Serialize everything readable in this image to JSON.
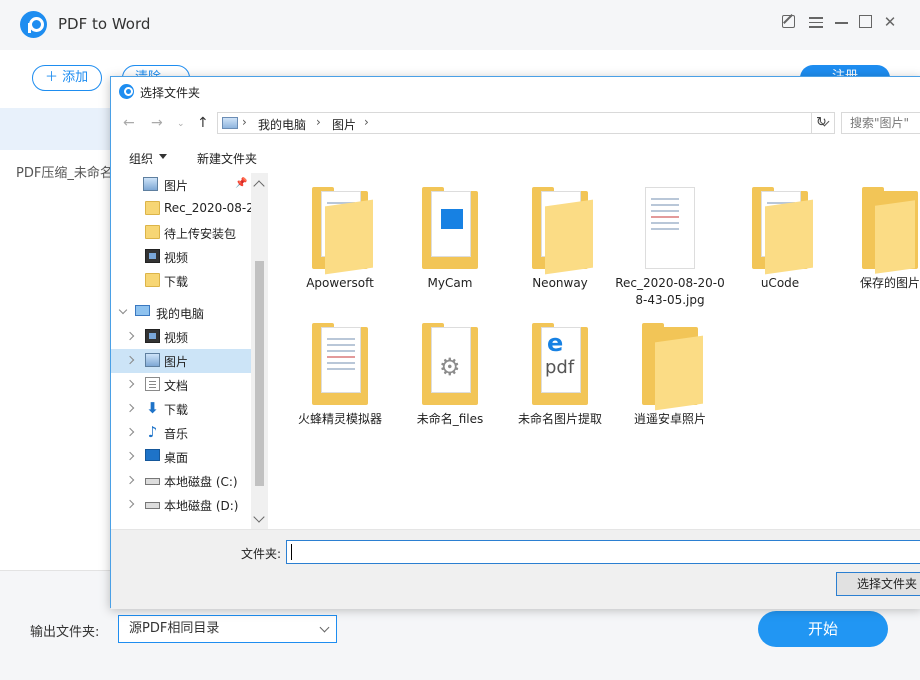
{
  "app": {
    "title": "PDF to Word",
    "add_label": "＋ 添加",
    "clear_label": "清除",
    "register_label": "注册",
    "file_row": "PDF压缩_未命名",
    "output_label": "输出文件夹:",
    "output_value": "源PDF相同目录",
    "start_label": "开始",
    "accent": "#1e8df0"
  },
  "dialog": {
    "title": "选择文件夹",
    "breadcrumbs": [
      "我的电脑",
      "图片"
    ],
    "search_placeholder": "搜索\"图片\"",
    "toolbar": {
      "organize": "组织",
      "new_folder": "新建文件夹"
    },
    "tree": [
      {
        "label": "图片",
        "icon": "picture-icon"
      },
      {
        "label": "Rec_2020-08-2",
        "icon": "folder-icon"
      },
      {
        "label": "待上传安装包",
        "icon": "folder-icon"
      },
      {
        "label": "视频",
        "icon": "video-icon"
      },
      {
        "label": "下载",
        "icon": "folder-icon"
      },
      {
        "label": "我的电脑",
        "icon": "computer-icon"
      },
      {
        "label": "视频",
        "icon": "video-icon"
      },
      {
        "label": "图片",
        "icon": "picture-icon"
      },
      {
        "label": "文档",
        "icon": "document-icon"
      },
      {
        "label": "下载",
        "icon": "download-icon"
      },
      {
        "label": "音乐",
        "icon": "music-icon"
      },
      {
        "label": "桌面",
        "icon": "desktop-icon"
      },
      {
        "label": "本地磁盘 (C:)",
        "icon": "drive-icon"
      },
      {
        "label": "本地磁盘 (D:)",
        "icon": "drive-icon"
      }
    ],
    "files": [
      {
        "name": "Apowersoft",
        "icon": "folder-docs-icon"
      },
      {
        "name": "MyCam",
        "icon": "folder-video-icon"
      },
      {
        "name": "Neonway",
        "icon": "folder-icon"
      },
      {
        "name": "Rec_2020-08-20-08-43-05.jpg",
        "icon": "image-file-icon"
      },
      {
        "name": "uCode",
        "icon": "folder-icon"
      },
      {
        "name": "保存的图片",
        "icon": "folder-icon"
      },
      {
        "name": "火蜂精灵模拟器",
        "icon": "folder-docs-icon"
      },
      {
        "name": "未命名_files",
        "icon": "folder-settings-icon"
      },
      {
        "name": "未命名图片提取",
        "icon": "folder-pdf-icon"
      },
      {
        "name": "逍遥安卓照片",
        "icon": "folder-icon"
      }
    ],
    "folder_label": "文件夹:",
    "folder_value": "",
    "select_button": "选择文件夹"
  }
}
